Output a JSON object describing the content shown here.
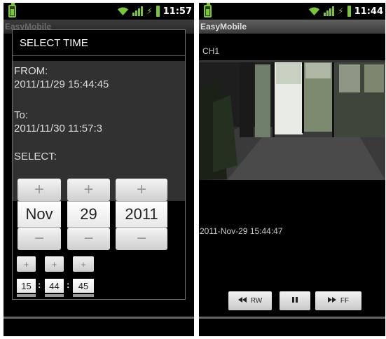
{
  "status_bar": {
    "left_time": "11:57",
    "right_time": "11:44"
  },
  "app_title": "EasyMobile",
  "dialog": {
    "title": "SELECT TIME",
    "from_label": "FROM:",
    "from_value": "2011/11/29 15:44:45",
    "to_label": "To:",
    "to_value": "2011/11/30 11:57:3",
    "select_label": "SELECT:",
    "date_pickers": [
      {
        "name": "month",
        "value": "Nov"
      },
      {
        "name": "day",
        "value": "29"
      },
      {
        "name": "year",
        "value": "2011"
      }
    ],
    "time_pickers": [
      {
        "name": "hour",
        "value": "15"
      },
      {
        "name": "minute",
        "value": "44"
      },
      {
        "name": "second",
        "value": "45"
      }
    ],
    "plus": "+",
    "minus": "−",
    "colon": ":"
  },
  "viewer": {
    "channel": "CH1",
    "timestamp": "2011-Nov-29 15:44:47",
    "controls": {
      "rw": "RW",
      "ff": "FF"
    }
  }
}
